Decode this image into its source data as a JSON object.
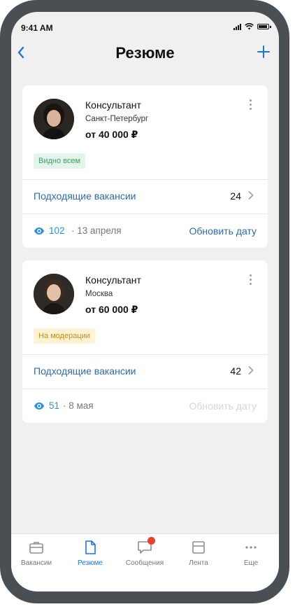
{
  "status_bar": {
    "time": "9:41 AM"
  },
  "nav": {
    "title": "Резюме"
  },
  "resumes": [
    {
      "position": "Консультант",
      "city": "Санкт-Петербург",
      "salary": "от 40 000 ₽",
      "badge": "Видно всем",
      "matching_label": "Подходящие вакансии",
      "matching_count": "24",
      "views": "102",
      "date": "· 13 апреля",
      "update_label": "Обновить дату",
      "update_enabled": true
    },
    {
      "position": "Консультант",
      "city": "Москва",
      "salary": "от 60 000 ₽",
      "badge": "На модерации",
      "matching_label": "Подходящие вакансии",
      "matching_count": "42",
      "views": "51",
      "date": "· 8 мая",
      "update_label": "Обновить дату",
      "update_enabled": false
    }
  ],
  "tabbar": {
    "items": [
      {
        "label": "Вакансии",
        "icon": "briefcase-icon"
      },
      {
        "label": "Резюме",
        "icon": "document-icon",
        "active": true
      },
      {
        "label": "Сообщения",
        "icon": "chat-icon",
        "notification": true
      },
      {
        "label": "Лента",
        "icon": "feed-icon"
      },
      {
        "label": "Еще",
        "icon": "more-icon"
      }
    ]
  },
  "colors": {
    "accent": "#1a73e8",
    "link": "#2b6cb0",
    "badge_green_bg": "#e3f4ea",
    "badge_yellow_bg": "#fff3d6",
    "notification": "#e8402d"
  }
}
